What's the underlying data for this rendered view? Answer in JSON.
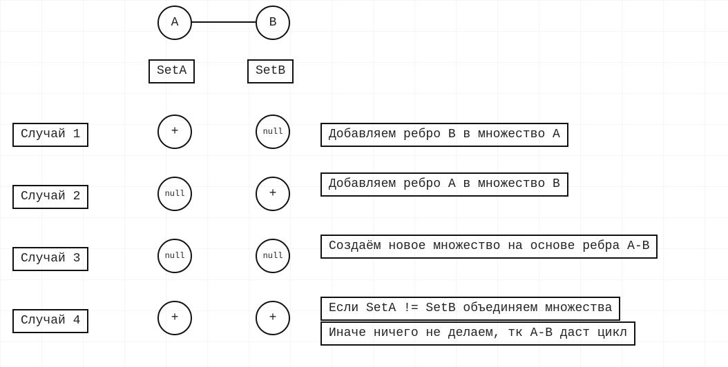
{
  "top": {
    "nodeA": "A",
    "nodeB": "B",
    "labelA": "SetA",
    "labelB": "SetB"
  },
  "rows": [
    {
      "case": "Случай 1",
      "a": "+",
      "b": "null",
      "descriptions": [
        "Добавляем ребро B в множество A"
      ]
    },
    {
      "case": "Случай 2",
      "a": "null",
      "b": "+",
      "descriptions": [
        "Добавляем ребро A в множество B"
      ]
    },
    {
      "case": "Случай 3",
      "a": "null",
      "b": "null",
      "descriptions": [
        "Создаём новое множество на основе ребра A-B"
      ]
    },
    {
      "case": "Случай 4",
      "a": "+",
      "b": "+",
      "descriptions": [
        "Если SetA != SetB объединяем множества",
        "Иначе ничего не делаем, тк A-B даст цикл"
      ]
    }
  ]
}
